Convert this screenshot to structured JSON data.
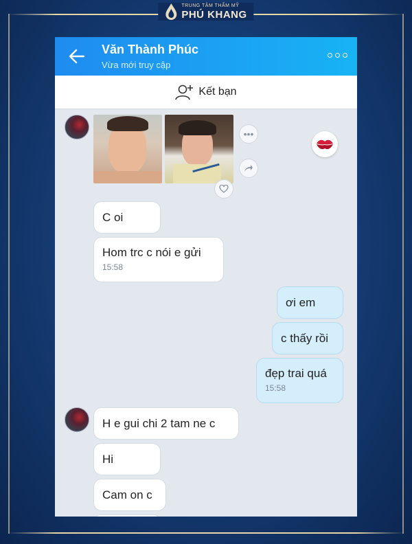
{
  "brand": {
    "subtitle": "TRUNG TÂM THẨM MỸ",
    "name": "PHÚ KHANG"
  },
  "header": {
    "contact_name": "Văn Thành Phúc",
    "status": "Vừa mới truy cập"
  },
  "friend_bar": {
    "label": "Kết bạn"
  },
  "messages": [
    {
      "from": "them",
      "text": "C oi"
    },
    {
      "from": "them",
      "text": "Hom trc c nói e gửi",
      "time": "15:58"
    },
    {
      "from": "me",
      "text": "ơi em"
    },
    {
      "from": "me",
      "text": "c thấy rồi"
    },
    {
      "from": "me",
      "text": "đẹp trai quá",
      "time": "15:58"
    },
    {
      "from": "them",
      "text": "H e gui chi 2 tam ne c"
    },
    {
      "from": "them",
      "text": "Hi"
    },
    {
      "from": "them",
      "text": "Cam on c"
    }
  ],
  "colors": {
    "header_start": "#1f8cf0",
    "header_end": "#18b3f5",
    "my_bubble": "#d5eefc",
    "chat_bg": "#e3e8ef"
  },
  "icons": [
    "back-arrow-icon",
    "more-options-icon",
    "add-friend-icon",
    "heart-icon",
    "share-icon",
    "kiss-sticker-icon"
  ]
}
